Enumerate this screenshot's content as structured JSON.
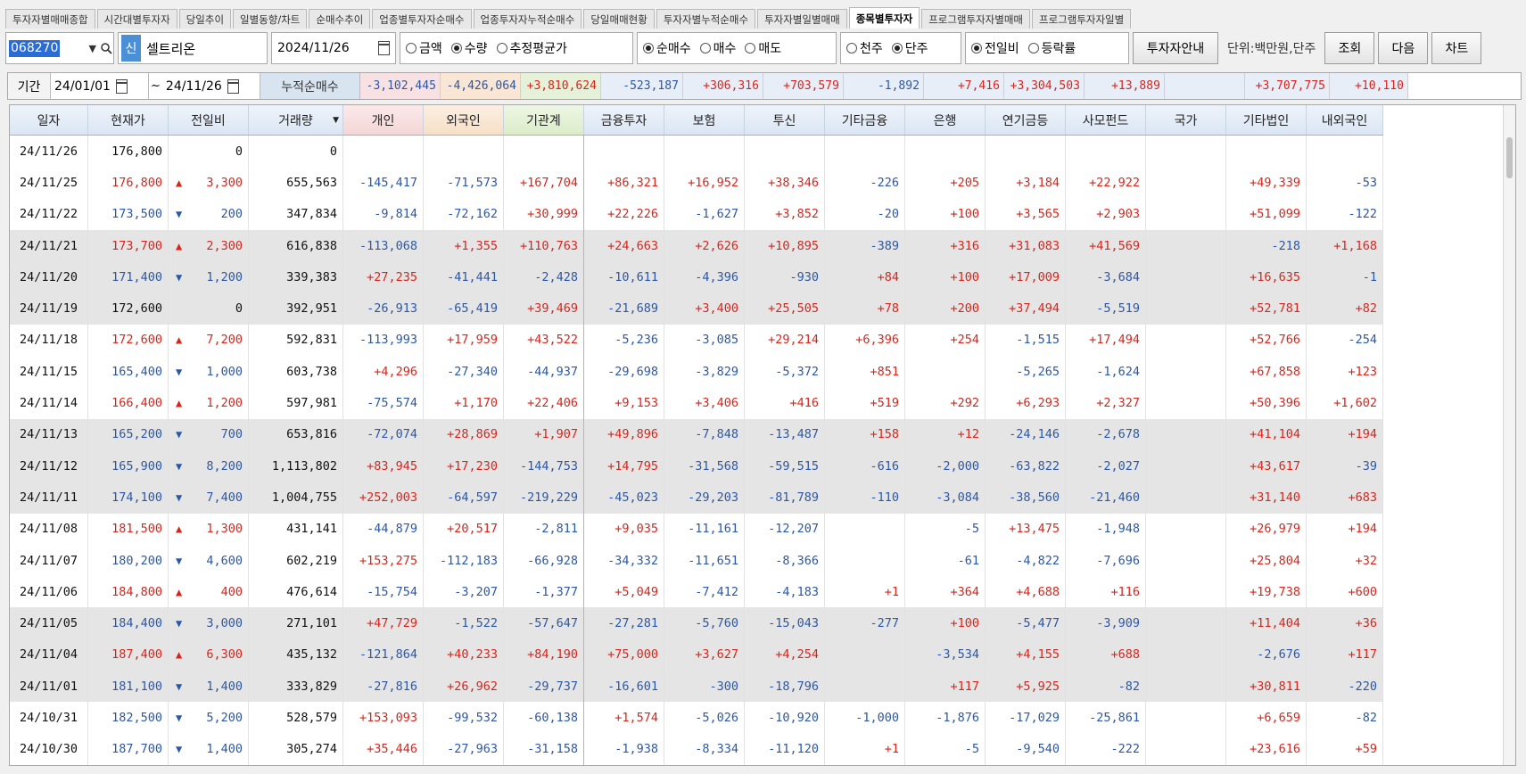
{
  "tabs": [
    "투자자별매매종합",
    "시간대별투자자",
    "당일추이",
    "일별동향/차트",
    "순매수추이",
    "업종별투자자순매수",
    "업종투자자누적순매수",
    "당일매매현황",
    "투자자별누적순매수",
    "투자자별일별매매",
    "종목별투자자",
    "프로그램투자자별매매",
    "프로그램투자자일별"
  ],
  "active_tab": 10,
  "toolbar": {
    "code_value": "068270",
    "new_badge": "신",
    "stock_name": "셀트리온",
    "date": "2024/11/26",
    "amount_options": [
      {
        "label": "금액",
        "checked": false
      },
      {
        "label": "수량",
        "checked": true
      },
      {
        "label": "추정평균가",
        "checked": false
      }
    ],
    "trade_options": [
      {
        "label": "순매수",
        "checked": true
      },
      {
        "label": "매수",
        "checked": false
      },
      {
        "label": "매도",
        "checked": false
      }
    ],
    "share_unit_options": [
      {
        "label": "천주",
        "checked": false
      },
      {
        "label": "단주",
        "checked": true
      }
    ],
    "compare_options": [
      {
        "label": "전일비",
        "checked": true
      },
      {
        "label": "등락률",
        "checked": false
      }
    ],
    "investor_guide_label": "투자자안내",
    "unit_text": "단위:백만원,단주",
    "query_label": "조회",
    "next_label": "다음",
    "chart_label": "차트"
  },
  "period": {
    "label": "기간",
    "start": "24/01/01",
    "tilde": "~",
    "end": "24/11/26",
    "cum_label": "누적순매수",
    "cum_values": [
      "-3,102,445",
      "-4,426,064",
      "+3,810,624",
      "-523,187",
      "+306,316",
      "+703,579",
      "-1,892",
      "+7,416",
      "+3,304,503",
      "+13,889",
      "",
      "+3,707,775",
      "+10,110"
    ]
  },
  "headers": [
    "일자",
    "현재가",
    "전일비",
    "거래량",
    "개인",
    "외국인",
    "기관계",
    "금융투자",
    "보험",
    "투신",
    "기타금융",
    "은행",
    "연기금등",
    "사모펀드",
    "국가",
    "기타법인",
    "내외국인"
  ],
  "rows": [
    [
      "24/11/26",
      "176,800",
      "",
      "0",
      "0",
      "",
      "",
      "",
      "",
      "",
      "",
      "",
      "",
      "",
      "",
      "",
      "",
      ""
    ],
    [
      "24/11/25",
      "176,800",
      "▲",
      "3,300",
      "655,563",
      "-145,417",
      "-71,573",
      "+167,704",
      "+86,321",
      "+16,952",
      "+38,346",
      "-226",
      "+205",
      "+3,184",
      "+22,922",
      "",
      "+49,339",
      "-53"
    ],
    [
      "24/11/22",
      "173,500",
      "▼",
      "200",
      "347,834",
      "-9,814",
      "-72,162",
      "+30,999",
      "+22,226",
      "-1,627",
      "+3,852",
      "-20",
      "+100",
      "+3,565",
      "+2,903",
      "",
      "+51,099",
      "-122"
    ],
    [
      "24/11/21",
      "173,700",
      "▲",
      "2,300",
      "616,838",
      "-113,068",
      "+1,355",
      "+110,763",
      "+24,663",
      "+2,626",
      "+10,895",
      "-389",
      "+316",
      "+31,083",
      "+41,569",
      "",
      "-218",
      "+1,168"
    ],
    [
      "24/11/20",
      "171,400",
      "▼",
      "1,200",
      "339,383",
      "+27,235",
      "-41,441",
      "-2,428",
      "-10,611",
      "-4,396",
      "-930",
      "+84",
      "+100",
      "+17,009",
      "-3,684",
      "",
      "+16,635",
      "-1"
    ],
    [
      "24/11/19",
      "172,600",
      "",
      "0",
      "392,951",
      "-26,913",
      "-65,419",
      "+39,469",
      "-21,689",
      "+3,400",
      "+25,505",
      "+78",
      "+200",
      "+37,494",
      "-5,519",
      "",
      "+52,781",
      "+82"
    ],
    [
      "24/11/18",
      "172,600",
      "▲",
      "7,200",
      "592,831",
      "-113,993",
      "+17,959",
      "+43,522",
      "-5,236",
      "-3,085",
      "+29,214",
      "+6,396",
      "+254",
      "-1,515",
      "+17,494",
      "",
      "+52,766",
      "-254"
    ],
    [
      "24/11/15",
      "165,400",
      "▼",
      "1,000",
      "603,738",
      "+4,296",
      "-27,340",
      "-44,937",
      "-29,698",
      "-3,829",
      "-5,372",
      "+851",
      "",
      "-5,265",
      "-1,624",
      "",
      "+67,858",
      "+123"
    ],
    [
      "24/11/14",
      "166,400",
      "▲",
      "1,200",
      "597,981",
      "-75,574",
      "+1,170",
      "+22,406",
      "+9,153",
      "+3,406",
      "+416",
      "+519",
      "+292",
      "+6,293",
      "+2,327",
      "",
      "+50,396",
      "+1,602"
    ],
    [
      "24/11/13",
      "165,200",
      "▼",
      "700",
      "653,816",
      "-72,074",
      "+28,869",
      "+1,907",
      "+49,896",
      "-7,848",
      "-13,487",
      "+158",
      "+12",
      "-24,146",
      "-2,678",
      "",
      "+41,104",
      "+194"
    ],
    [
      "24/11/12",
      "165,900",
      "▼",
      "8,200",
      "1,113,802",
      "+83,945",
      "+17,230",
      "-144,753",
      "+14,795",
      "-31,568",
      "-59,515",
      "-616",
      "-2,000",
      "-63,822",
      "-2,027",
      "",
      "+43,617",
      "-39"
    ],
    [
      "24/11/11",
      "174,100",
      "▼",
      "7,400",
      "1,004,755",
      "+252,003",
      "-64,597",
      "-219,229",
      "-45,023",
      "-29,203",
      "-81,789",
      "-110",
      "-3,084",
      "-38,560",
      "-21,460",
      "",
      "+31,140",
      "+683"
    ],
    [
      "24/11/08",
      "181,500",
      "▲",
      "1,300",
      "431,141",
      "-44,879",
      "+20,517",
      "-2,811",
      "+9,035",
      "-11,161",
      "-12,207",
      "",
      "-5",
      "+13,475",
      "-1,948",
      "",
      "+26,979",
      "+194"
    ],
    [
      "24/11/07",
      "180,200",
      "▼",
      "4,600",
      "602,219",
      "+153,275",
      "-112,183",
      "-66,928",
      "-34,332",
      "-11,651",
      "-8,366",
      "",
      "-61",
      "-4,822",
      "-7,696",
      "",
      "+25,804",
      "+32"
    ],
    [
      "24/11/06",
      "184,800",
      "▲",
      "400",
      "476,614",
      "-15,754",
      "-3,207",
      "-1,377",
      "+5,049",
      "-7,412",
      "-4,183",
      "+1",
      "+364",
      "+4,688",
      "+116",
      "",
      "+19,738",
      "+600"
    ],
    [
      "24/11/05",
      "184,400",
      "▼",
      "3,000",
      "271,101",
      "+47,729",
      "-1,522",
      "-57,647",
      "-27,281",
      "-5,760",
      "-15,043",
      "-277",
      "+100",
      "-5,477",
      "-3,909",
      "",
      "+11,404",
      "+36"
    ],
    [
      "24/11/04",
      "187,400",
      "▲",
      "6,300",
      "435,132",
      "-121,864",
      "+40,233",
      "+84,190",
      "+75,000",
      "+3,627",
      "+4,254",
      "",
      "-3,534",
      "+4,155",
      "+688",
      "",
      "-2,676",
      "+117"
    ],
    [
      "24/11/01",
      "181,100",
      "▼",
      "1,400",
      "333,829",
      "-27,816",
      "+26,962",
      "-29,737",
      "-16,601",
      "-300",
      "-18,796",
      "",
      "+117",
      "+5,925",
      "-82",
      "",
      "+30,811",
      "-220"
    ],
    [
      "24/10/31",
      "182,500",
      "▼",
      "5,200",
      "528,579",
      "+153,093",
      "-99,532",
      "-60,138",
      "+1,574",
      "-5,026",
      "-10,920",
      "-1,000",
      "-1,876",
      "-17,029",
      "-25,861",
      "",
      "+6,659",
      "-82"
    ],
    [
      "24/10/30",
      "187,700",
      "▼",
      "1,400",
      "305,274",
      "+35,446",
      "-27,963",
      "-31,158",
      "-1,938",
      "-8,334",
      "-11,120",
      "+1",
      "-5",
      "-9,540",
      "-222",
      "",
      "+23,616",
      "+59"
    ]
  ],
  "colors": {
    "up": "#d8251c",
    "down": "#2b58a6",
    "row_shade": "#e5e5e5"
  }
}
